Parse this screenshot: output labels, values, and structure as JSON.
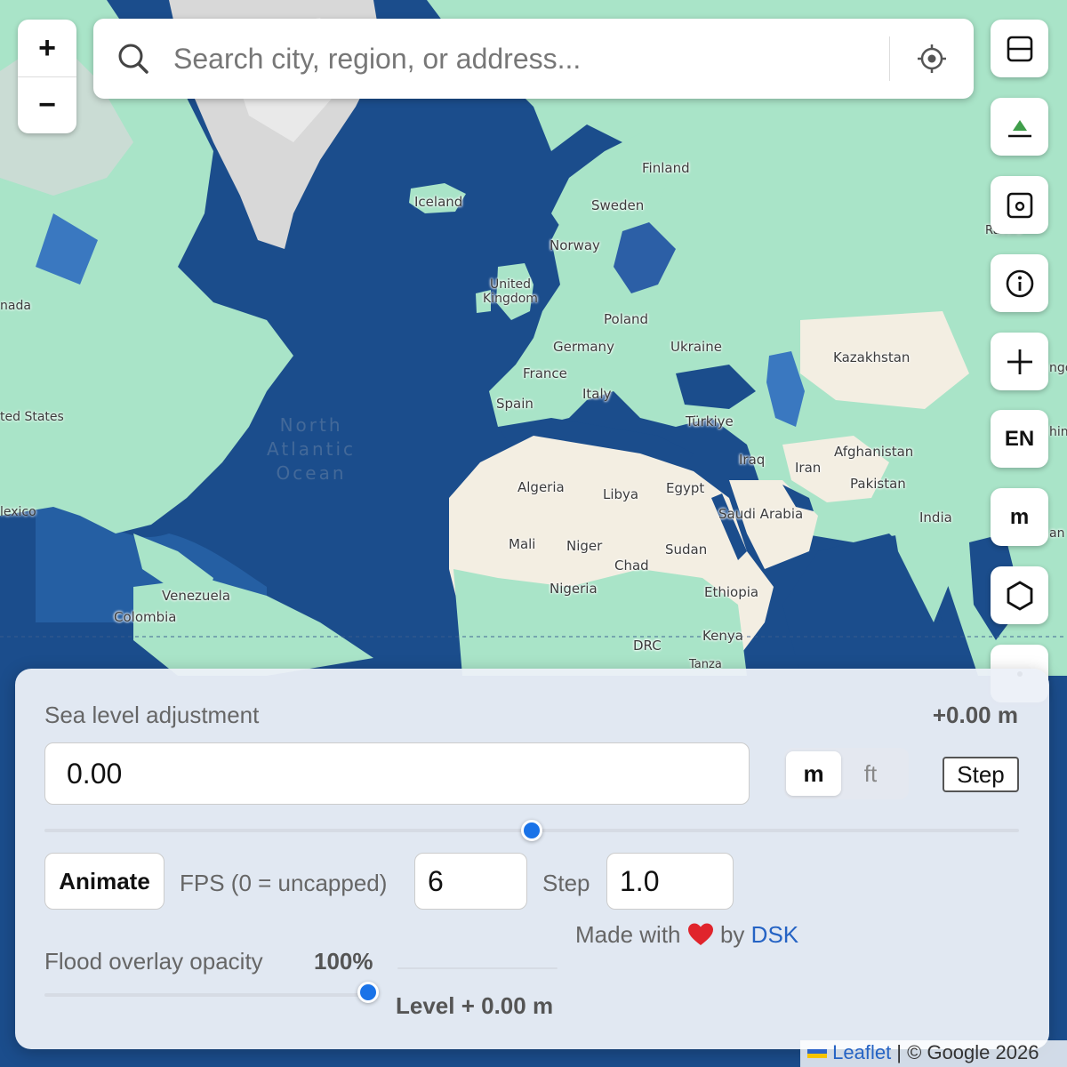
{
  "map": {
    "labels": {
      "finland": "Finland",
      "iceland": "Iceland",
      "sweden": "Sweden",
      "norway": "Norway",
      "uk": "United\nKingdom",
      "poland": "Poland",
      "germany": "Germany",
      "ukraine": "Ukraine",
      "kazakhstan": "Kazakhstan",
      "france": "France",
      "italy": "Italy",
      "spain": "Spain",
      "turkiye": "Türkiye",
      "iraq": "Iraq",
      "iran": "Iran",
      "afghanistan": "Afghanistan",
      "pakistan": "Pakistan",
      "algeria": "Algeria",
      "libya": "Libya",
      "egypt": "Egypt",
      "saudi": "Saudi Arabia",
      "india": "India",
      "mali": "Mali",
      "niger": "Niger",
      "sudan": "Sudan",
      "chad": "Chad",
      "nigeria": "Nigeria",
      "ethiopia": "Ethiopia",
      "venezuela": "Venezuela",
      "colombia": "Colombia",
      "drc": "DRC",
      "kenya": "Kenya",
      "canada": "nada",
      "us": "ted States",
      "mexico": "lexico",
      "russia": "Russia",
      "mongolia": "ngo",
      "china": "hin",
      "bangladesh": "an",
      "tanzania": "Tanza"
    },
    "ocean": "North\nAtlantic\nOcean"
  },
  "zoom": {
    "in": "+",
    "out": "−"
  },
  "search": {
    "placeholder": "Search city, region, or address..."
  },
  "tools": {
    "language": "EN",
    "unit": "m"
  },
  "panel": {
    "title": "Sea level adjustment",
    "readout": "+0.00 m",
    "level_input": "0.00",
    "unit_m": "m",
    "unit_ft": "ft",
    "step_button": "Step",
    "slider_fraction": 0.5,
    "animate_button": "Animate",
    "fps_label": "FPS (0 = uncapped)",
    "fps_value": "6",
    "step_label": "Step",
    "step_value": "1.0",
    "credit_prefix": "Made with",
    "credit_by": "by",
    "credit_author": "DSK",
    "opacity_label": "Flood overlay opacity",
    "opacity_value": "100%",
    "opacity_fraction": 1.0,
    "level_summary": "Level + 0.00 m"
  },
  "attribution": {
    "leaflet": "Leaflet",
    "sep": " | ",
    "google": "© Google 2026"
  },
  "colors": {
    "ocean": "#1b4d8c",
    "land": "#a9e4c8",
    "desert": "#f3eee2",
    "accent": "#1a73e8",
    "link": "#2563c4",
    "heart": "#e0242c"
  }
}
